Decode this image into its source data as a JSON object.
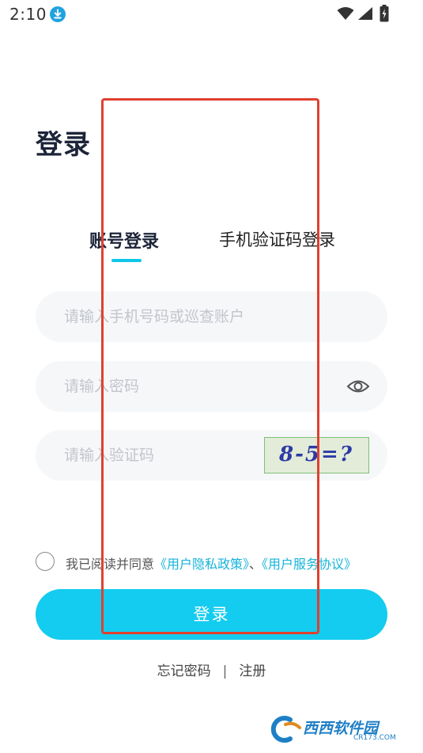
{
  "status_bar": {
    "time": "2:10",
    "icons": [
      "download-icon",
      "wifi-icon",
      "signal-icon",
      "battery-charging-icon"
    ]
  },
  "page": {
    "title": "登录"
  },
  "tabs": [
    {
      "label": "账号登录",
      "active": true
    },
    {
      "label": "手机验证码登录",
      "active": false
    }
  ],
  "form": {
    "account_placeholder": "请输入手机号码或巡查账户",
    "account_value": "",
    "password_placeholder": "请输入密码",
    "password_value": "",
    "captcha_placeholder": "请输入验证码",
    "captcha_value": "",
    "captcha_image_text": "8-5=?"
  },
  "agreement": {
    "prefix": "我已阅读并同意",
    "privacy_link": "《用户隐私政策》",
    "separator": "、",
    "service_link": "《用户服务协议》",
    "checked": false
  },
  "login_button": {
    "label": "登录"
  },
  "bottom_links": {
    "forgot_password": "忘记密码",
    "divider": "|",
    "register": "注册"
  },
  "watermark": {
    "brand": "西西软件园",
    "domain": "CR173.COM"
  },
  "colors": {
    "accent": "#13ccef",
    "link": "#16b3d8",
    "title": "#1c2438",
    "annotation": "#e0402f"
  }
}
